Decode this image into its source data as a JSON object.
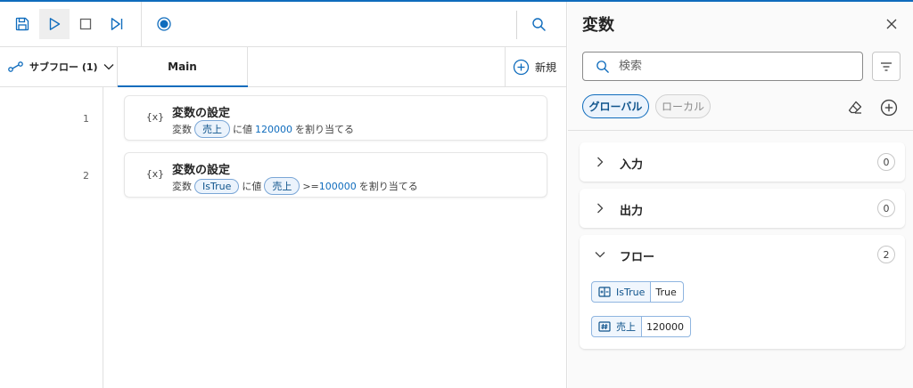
{
  "toolbar": {
    "save": "save-icon",
    "run": "play-icon",
    "stop": "stop-icon",
    "next": "run-next-icon",
    "record": "record-icon",
    "search": "search-icon"
  },
  "tabs": {
    "subflow_label": "サブフロー (1)",
    "main_label": "Main",
    "new_label": "新規"
  },
  "actions": [
    {
      "line": "1",
      "icon": "{x}",
      "title": "変数の設定",
      "prefix": "変数",
      "var": "売上",
      "mid": "に値",
      "value": "120000",
      "suffix": "を割り当てる"
    },
    {
      "line": "2",
      "icon": "{x}",
      "title": "変数の設定",
      "prefix": "変数",
      "var": "IsTrue",
      "mid": "に値",
      "value_var": "売上",
      "op": ">=",
      "value": "100000",
      "suffix": "を割り当てる"
    }
  ],
  "variables_pane": {
    "title": "変数",
    "search_placeholder": "検索",
    "toggle_global": "グローバル",
    "toggle_local": "ローカル",
    "sections": [
      {
        "label": "入力",
        "count": "0",
        "expanded": false
      },
      {
        "label": "出力",
        "count": "0",
        "expanded": false
      },
      {
        "label": "フロー",
        "count": "2",
        "expanded": true
      }
    ],
    "flow_vars": [
      {
        "name": "IsTrue",
        "value": "True",
        "type_icon": "boolean-icon"
      },
      {
        "name": "売上",
        "value": "120000",
        "type_icon": "number-icon"
      }
    ]
  },
  "colors": {
    "accent": "#0f6cbd",
    "chip_bg": "#ebf3fc",
    "chip_border": "#7aa6d6"
  }
}
